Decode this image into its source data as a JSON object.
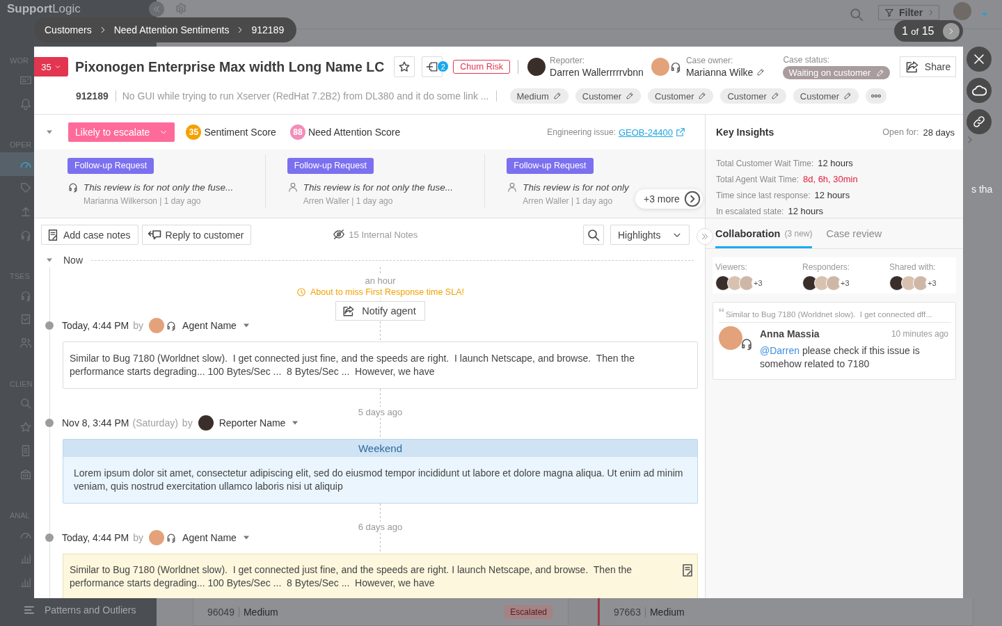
{
  "app": {
    "logo": "**Support**Logic",
    "sidebar": {
      "sections": [
        {
          "label": "WOR",
          "items": [
            {
              "selected": false
            },
            {
              "selected": false
            }
          ]
        },
        {
          "label": "OPER",
          "items": [
            {
              "selected": true
            },
            {
              "selected": false
            },
            {
              "selected": false
            },
            {
              "selected": false
            }
          ]
        },
        {
          "label": "TSES",
          "items": [
            {
              "selected": false
            },
            {
              "selected": false
            },
            {
              "selected": false
            }
          ]
        },
        {
          "label": "CLIEN",
          "items": [
            {
              "selected": false
            },
            {
              "selected": false
            },
            {
              "selected": false
            },
            {
              "selected": false
            }
          ]
        },
        {
          "label": "ANAL",
          "items": [
            {
              "selected": false
            },
            {
              "selected": false
            },
            {
              "selected": false
            }
          ]
        }
      ],
      "footer": "Patterns and Outliers"
    },
    "topbar": {
      "filter": "Filter"
    },
    "cards": [
      {
        "id": "96049",
        "priority": "Medium",
        "badge": "Escalated",
        "flagged": false
      },
      {
        "id": "97663",
        "priority": "Medium",
        "flagged": true
      }
    ],
    "side_text": "s tha"
  },
  "breadcrumb": [
    "Customers",
    "Need Attention Sentiments",
    "912189"
  ],
  "pager": {
    "current": "1",
    "separator": "of",
    "total": "15"
  },
  "case": {
    "score": "35",
    "title": "Pixonogen Enterprise Max width Long Name LC",
    "starred": false,
    "linked_count": "2",
    "risk_tag": "Churn Risk",
    "reporter": {
      "label": "Reporter:",
      "name": "Darren Wallerrrrrvbnn"
    },
    "owner": {
      "label": "Case owner:",
      "name": "Marianna Wilke"
    },
    "status": {
      "label": "Case status:",
      "value": "Waiting on customer"
    },
    "share": "Share",
    "id": "912189",
    "summary": "No GUI while trying to run Xserver (RedHat 7.2B2) from DL380 and it do some link ...",
    "tags": [
      "Medium",
      "Customer",
      "Customer",
      "Customer",
      "Customer"
    ]
  },
  "signals": {
    "expanded": true,
    "escalation": "Likely to escalate",
    "scores": [
      {
        "value": "35",
        "label": "Sentiment Score",
        "color": "#f5a100"
      },
      {
        "value": "88",
        "label": "Need Attention Score",
        "color": "#f28db8"
      }
    ],
    "engineering_issue": {
      "label": "Engineering issue:",
      "link": "GEOB-24400"
    },
    "highlights": [
      {
        "tag": "Follow-up Request",
        "kind": "agent",
        "text": "This review is for not only the fuse...",
        "meta": "Marianna Wilkerson | 1 day ago"
      },
      {
        "tag": "Follow-up Request",
        "kind": "customer",
        "text": "This review is for not only the fuse...",
        "meta": "Arren Waller | 1 day ago"
      },
      {
        "tag": "Follow-up Request",
        "kind": "customer",
        "text": "This review is for not only",
        "meta": "Arren Waller | 1 day ago"
      }
    ],
    "more": "+3 more"
  },
  "key_insights": {
    "title": "Key Insights",
    "open_for": {
      "label": "Open for:",
      "value": "28 days"
    },
    "rows": [
      {
        "label": "Total Customer Wait Time:",
        "value": "12 hours",
        "alert": false
      },
      {
        "label": "Total Agent Wait Time:",
        "value": "8d, 6h, 30min",
        "alert": true
      },
      {
        "label": "Time since last response:",
        "value": "12 hours",
        "alert": false
      },
      {
        "label": "In escalated state:",
        "value": "12 hours",
        "alert": false
      }
    ]
  },
  "toolbar": {
    "add_notes": "Add case notes",
    "reply": "Reply to customer",
    "internal_notes": "15 Internal Notes",
    "filter": "Highlights"
  },
  "timeline": {
    "label": "Now",
    "expanded": true,
    "entries": [
      {
        "ago": "an hour",
        "sla": {
          "warning": "About to miss First Response time SLA!",
          "action": "Notify agent"
        },
        "time": "Today, 4:44 PM",
        "by": "by",
        "author": "Agent Name",
        "agent": true,
        "kind": "message",
        "text": "Similar to Bug 7180 (Worldnet slow).  I get connected just fine, and the speeds are right.  I launch Netscape, and browse.  Then the performance starts degrading... 100 Bytes/Sec ...  8 Bytes/Sec ...  However, we have"
      },
      {
        "ago": "5 days ago",
        "time": "Nov 8, 3:44 PM",
        "weekday": "(Saturday)",
        "by": "by",
        "author": "Reporter Name",
        "agent": false,
        "kind": "weekend",
        "banner": "Weekend",
        "text": "Lorem ipsum dolor sit amet, consectetur adipiscing elit, sed do eiusmod tempor incididunt ut labore et dolore magna aliqua. Ut enim ad minim veniam, quis nostrud exercitation ullamco laboris nisi ut aliquip"
      },
      {
        "ago": "6 days ago",
        "time": "Today, 4:44 PM",
        "by": "by",
        "author": "Agent Name",
        "agent": true,
        "kind": "note",
        "text": "Similar to Bug 7180 (Worldnet slow).  I get connected just fine, and the speeds are right. I launch Netscape, and browse.  Then the performance starts degrading... 100 Bytes/Sec ...  8 Bytes/Sec ...  However, we have"
      }
    ]
  },
  "collaboration": {
    "tabs": [
      {
        "label": "Collaboration",
        "badge": "(3 new)",
        "selected": true
      },
      {
        "label": "Case review",
        "selected": false
      }
    ],
    "participants": [
      {
        "label": "Viewers:",
        "extra": "+3"
      },
      {
        "label": "Responders:",
        "extra": "+3"
      },
      {
        "label": "Shared with:",
        "extra": "+3"
      }
    ],
    "comments": [
      {
        "quote": "Similar to Bug 7180 (Worldnet slow).  I get connected dff...",
        "author": "Anna Massia",
        "agent": true,
        "time": "10 minutes ago",
        "mention": "@Darren",
        "text": "please check if this issue is somehow related to 7180"
      }
    ]
  }
}
